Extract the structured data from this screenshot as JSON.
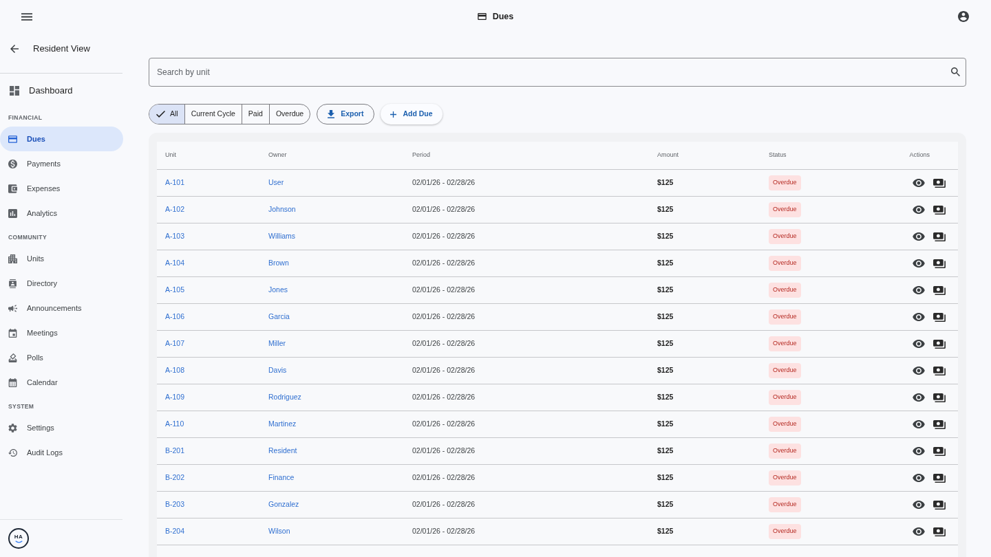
{
  "top_bar": {
    "title": "Dues"
  },
  "sidebar": {
    "back_link": "Resident View",
    "dashboard": {
      "label": "Dashboard",
      "selected": false
    },
    "sections": [
      {
        "heading": "FINANCIAL",
        "items": [
          {
            "label": "Dues",
            "selected": true
          },
          {
            "label": "Payments",
            "selected": false
          },
          {
            "label": "Expenses",
            "selected": false
          },
          {
            "label": "Analytics",
            "selected": false
          }
        ]
      },
      {
        "heading": "COMMUNITY",
        "items": [
          {
            "label": "Units",
            "selected": false
          },
          {
            "label": "Directory",
            "selected": false
          },
          {
            "label": "Announcements",
            "selected": false
          },
          {
            "label": "Meetings",
            "selected": false
          },
          {
            "label": "Polls",
            "selected": false
          },
          {
            "label": "Calendar",
            "selected": false
          }
        ]
      },
      {
        "heading": "SYSTEM",
        "items": [
          {
            "label": "Settings",
            "selected": false
          },
          {
            "label": "Audit Logs",
            "selected": false
          }
        ]
      }
    ],
    "logo_text": "HA"
  },
  "search": {
    "placeholder": "Search by unit"
  },
  "filters": [
    {
      "label": "All",
      "selected": true
    },
    {
      "label": "Current Cycle",
      "selected": false
    },
    {
      "label": "Paid",
      "selected": false
    },
    {
      "label": "Overdue",
      "selected": false
    }
  ],
  "actions": [
    {
      "label": "Export",
      "kind": "outlined"
    },
    {
      "label": "Add Due",
      "kind": "elevated"
    }
  ],
  "table": {
    "columns": [
      "Unit",
      "Owner",
      "Period",
      "Amount",
      "Status",
      "Actions"
    ],
    "rows": [
      {
        "unit": "A-101",
        "owner": "User",
        "period": "02/01/26 - 02/28/26",
        "amount": "$125",
        "status": "Overdue"
      },
      {
        "unit": "A-102",
        "owner": "Johnson",
        "period": "02/01/26 - 02/28/26",
        "amount": "$125",
        "status": "Overdue"
      },
      {
        "unit": "A-103",
        "owner": "Williams",
        "period": "02/01/26 - 02/28/26",
        "amount": "$125",
        "status": "Overdue"
      },
      {
        "unit": "A-104",
        "owner": "Brown",
        "period": "02/01/26 - 02/28/26",
        "amount": "$125",
        "status": "Overdue"
      },
      {
        "unit": "A-105",
        "owner": "Jones",
        "period": "02/01/26 - 02/28/26",
        "amount": "$125",
        "status": "Overdue"
      },
      {
        "unit": "A-106",
        "owner": "Garcia",
        "period": "02/01/26 - 02/28/26",
        "amount": "$125",
        "status": "Overdue"
      },
      {
        "unit": "A-107",
        "owner": "Miller",
        "period": "02/01/26 - 02/28/26",
        "amount": "$125",
        "status": "Overdue"
      },
      {
        "unit": "A-108",
        "owner": "Davis",
        "period": "02/01/26 - 02/28/26",
        "amount": "$125",
        "status": "Overdue"
      },
      {
        "unit": "A-109",
        "owner": "Rodriguez",
        "period": "02/01/26 - 02/28/26",
        "amount": "$125",
        "status": "Overdue"
      },
      {
        "unit": "A-110",
        "owner": "Martinez",
        "period": "02/01/26 - 02/28/26",
        "amount": "$125",
        "status": "Overdue"
      },
      {
        "unit": "B-201",
        "owner": "Resident",
        "period": "02/01/26 - 02/28/26",
        "amount": "$125",
        "status": "Overdue"
      },
      {
        "unit": "B-202",
        "owner": "Finance",
        "period": "02/01/26 - 02/28/26",
        "amount": "$125",
        "status": "Overdue"
      },
      {
        "unit": "B-203",
        "owner": "Gonzalez",
        "period": "02/01/26 - 02/28/26",
        "amount": "$125",
        "status": "Overdue"
      },
      {
        "unit": "B-204",
        "owner": "Wilson",
        "period": "02/01/26 - 02/28/26",
        "amount": "$125",
        "status": "Overdue"
      }
    ]
  }
}
